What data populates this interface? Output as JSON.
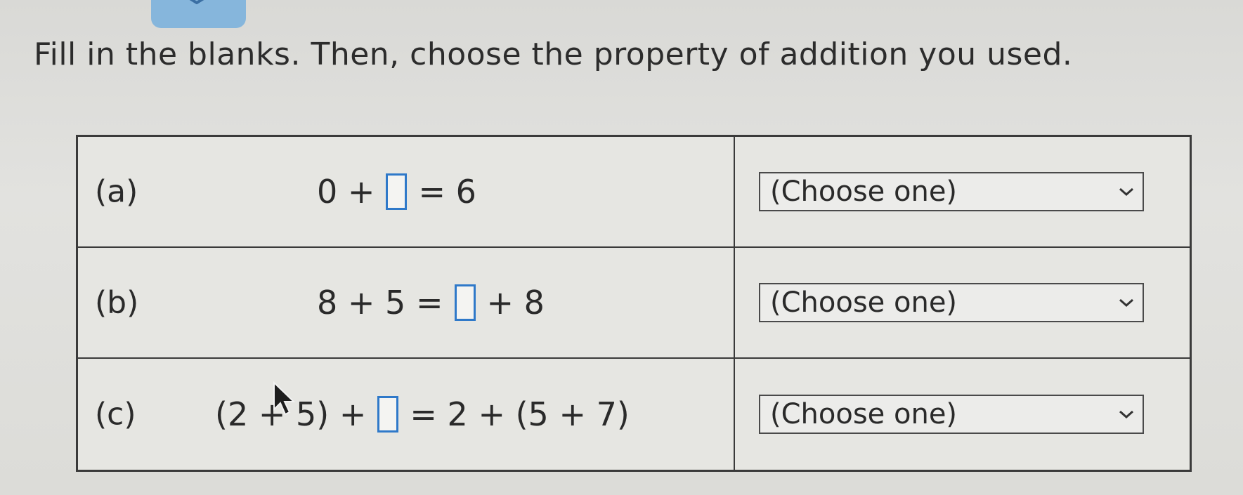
{
  "prompt": "Fill in the blanks. Then, choose the property of addition you used.",
  "rows": [
    {
      "label": "(a)",
      "expr": {
        "before": "0 +",
        "after": "=  6"
      },
      "select": "(Choose one)"
    },
    {
      "label": "(b)",
      "expr": {
        "before": "8 + 5 =",
        "after": "+ 8"
      },
      "select": "(Choose one)"
    },
    {
      "label": "(c)",
      "expr": {
        "before": "(2 + 5) +",
        "after": "=  2 + (5 + 7)"
      },
      "select": "(Choose one)"
    }
  ],
  "icons": {
    "dropdown": "chevron-down-icon",
    "cursor": "mouse-pointer-icon",
    "top_tab": "chevron-down-icon"
  },
  "colors": {
    "blank_border": "#2f79c9",
    "tab": "#86b6dc"
  }
}
